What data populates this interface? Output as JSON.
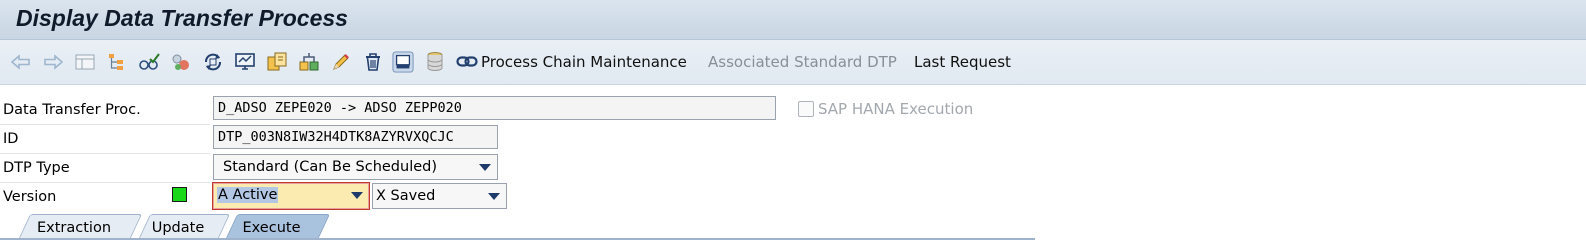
{
  "window": {
    "title": "Display Data Transfer Process"
  },
  "toolbar": {
    "icons": [
      "back-arrow-icon",
      "forward-arrow-icon",
      "list-display-icon",
      "hierarchy-icon",
      "check-glasses-icon",
      "object-network-icon",
      "activate-refresh-icon",
      "monitor-icon",
      "copy-objects-icon",
      "where-used-icon",
      "edit-pencil-icon",
      "delete-trash-icon",
      "transport-icon",
      "database-icon",
      "process-chain-link-icon"
    ],
    "process_chain_label": "Process Chain Maintenance",
    "associated_dtp_label": "Associated Standard DTP",
    "last_request_label": "Last Request"
  },
  "form": {
    "dtp_label": "Data Transfer Proc.",
    "dtp_value": "D_ADSO ZEPE020 -> ADSO ZEPP020",
    "id_label": "ID",
    "id_value": "DTP_003N8IW32H4DTK8AZYRVXQCJC",
    "type_label": "DTP Type",
    "type_value": "Standard (Can Be Scheduled)",
    "version_label": "Version",
    "version_status_color": "#19d719",
    "version_value": "A Active",
    "saved_value": "X Saved",
    "hana_label": "SAP HANA Execution"
  },
  "tabs": [
    {
      "label": "Extraction",
      "selected": false
    },
    {
      "label": "Update",
      "selected": false
    },
    {
      "label": "Execute",
      "selected": true
    }
  ],
  "colors": {
    "title_bar": "#cfdbe7",
    "toolbar": "#e5ecf3",
    "selected_tab": "#a9c2de",
    "active_field": "#fcebb0",
    "focus_border": "#c0392b"
  }
}
